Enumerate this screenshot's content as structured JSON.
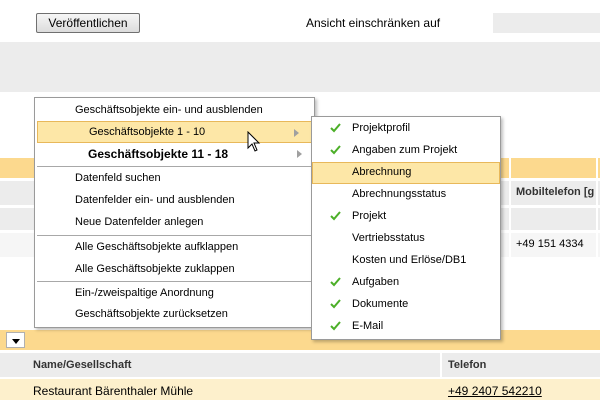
{
  "toolbar": {
    "publish_label": "Veröffentlichen",
    "view_restrict_label": "Ansicht einschränken auf"
  },
  "background_table": {
    "mobile_header": "Mobiltelefon [g",
    "mobile_value": "+49 151 4334"
  },
  "context_menu": {
    "items": [
      {
        "label": "Geschäftsobjekte ein- und ausblenden"
      },
      {
        "label": "Geschäftsobjekte 1 - 10",
        "submenu": true,
        "highlighted": true
      },
      {
        "label": "Geschäftsobjekte 11 - 18",
        "submenu": true,
        "bold": true
      },
      {
        "label": "Datenfeld suchen"
      },
      {
        "label": "Datenfelder ein- und ausblenden"
      },
      {
        "label": "Neue Datenfelder anlegen"
      },
      {
        "label": "Alle Geschäftsobjekte aufklappen"
      },
      {
        "label": "Alle Geschäftsobjekte zuklappen"
      },
      {
        "label": "Ein-/zweispaltige Anordnung"
      },
      {
        "label": "Geschäftsobjekte zurücksetzen"
      }
    ]
  },
  "submenu": {
    "items": [
      {
        "label": "Projektprofil",
        "checked": true
      },
      {
        "label": "Angaben zum Projekt",
        "checked": true
      },
      {
        "label": "Abrechnung",
        "checked": false,
        "highlighted": true
      },
      {
        "label": "Abrechnungsstatus",
        "checked": false
      },
      {
        "label": "Projekt",
        "checked": true
      },
      {
        "label": "Vertriebsstatus",
        "checked": false
      },
      {
        "label": "Kosten und Erlöse/DB1",
        "checked": false
      },
      {
        "label": "Aufgaben",
        "checked": true
      },
      {
        "label": "Dokumente",
        "checked": true
      },
      {
        "label": "E-Mail",
        "checked": true
      }
    ]
  },
  "bottom_table": {
    "columns": [
      "Name/Gesellschaft",
      "Telefon"
    ],
    "rows": [
      {
        "name": "Restaurant Bärenthaler Mühle",
        "phone": "+49 2407 542210"
      }
    ]
  },
  "colors": {
    "accent_orange": "#fcd98e",
    "highlight": "#fde7a7",
    "check_green": "#4caf28",
    "band_gray": "#ececec"
  },
  "icons": {
    "check": "check-icon",
    "submenu_arrow": "chevron-right-icon",
    "dropdown": "chevron-down-icon",
    "cursor": "mouse-cursor-icon"
  }
}
